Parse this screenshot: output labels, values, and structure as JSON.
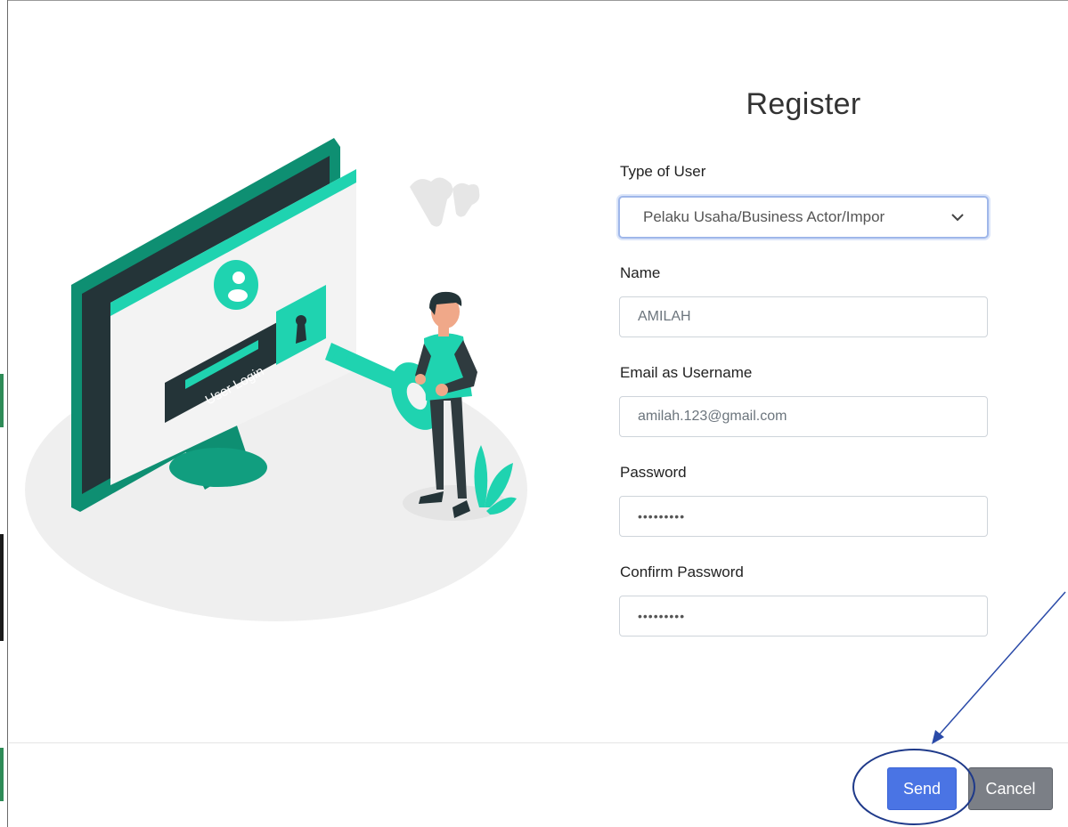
{
  "form": {
    "title": "Register",
    "type_label": "Type of User",
    "type_value": "Pelaku Usaha/Business Actor/Impor",
    "name_label": "Name",
    "name_value": "AMILAH",
    "email_label": "Email as Username",
    "email_value": "amilah.123@gmail.com",
    "password_label": "Password",
    "password_value": "•••••••••",
    "confirm_label": "Confirm Password",
    "confirm_value": "•••••••••"
  },
  "illustration": {
    "screen_text": "User Login"
  },
  "footer": {
    "send_label": "Send",
    "cancel_label": "Cancel"
  },
  "colors": {
    "accent_green": "#1fd3b0",
    "dark_green": "#0e8f72",
    "send_blue": "#4a74e4",
    "annotation_blue": "#2a4aa8"
  }
}
